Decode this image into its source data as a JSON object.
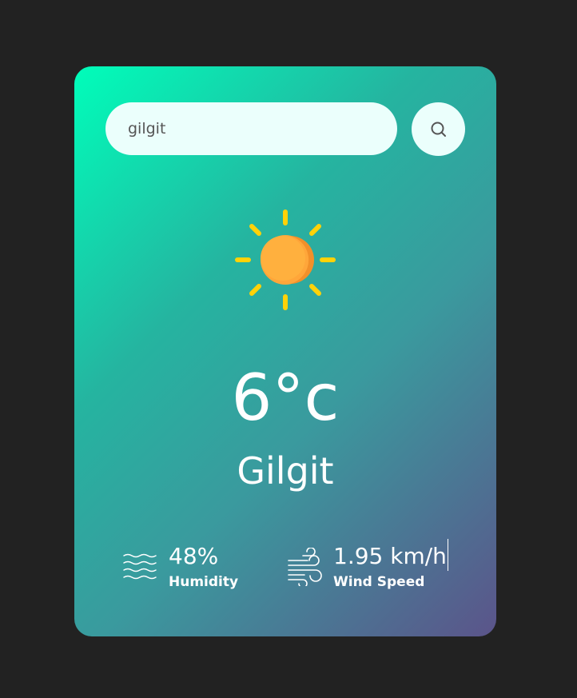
{
  "search": {
    "value": "gilgit",
    "button_icon": "search-icon"
  },
  "weather": {
    "icon": "sun-icon",
    "temperature": "6°c",
    "city": "Gilgit"
  },
  "details": {
    "humidity": {
      "icon": "humidity-icon",
      "value": "48%",
      "label": "Humidity"
    },
    "wind": {
      "icon": "wind-icon",
      "value": "1.95 km/h",
      "label": "Wind Speed"
    }
  },
  "colors": {
    "background": "#222222",
    "card_gradient_start": "#00feba",
    "card_gradient_end": "#5b548a",
    "input_bg": "#ebfffc",
    "sun_rays": "#ffd208",
    "sun_body": "#ffaa3b"
  }
}
